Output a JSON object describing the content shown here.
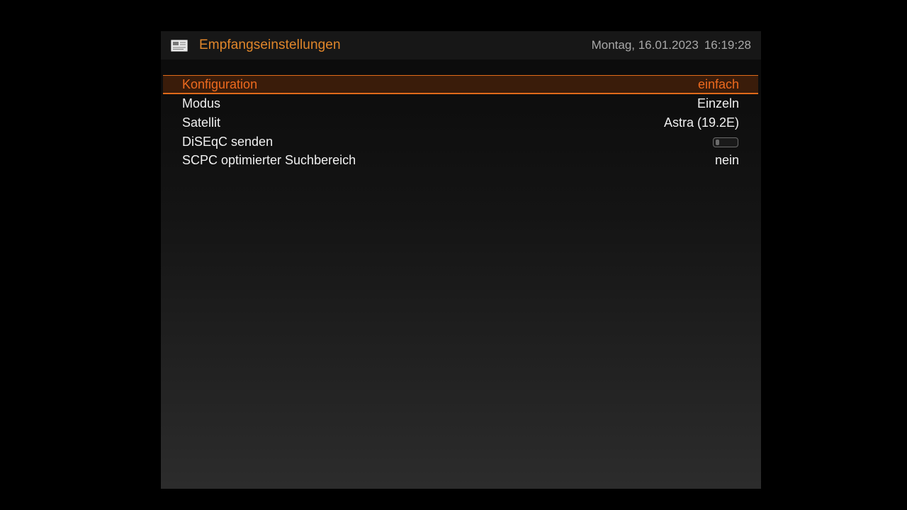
{
  "header": {
    "title": "Empfangseinstellungen",
    "date": "Montag, 16.01.2023",
    "time": "16:19:28",
    "icon": "satellite-dish-icon"
  },
  "menu": {
    "items": [
      {
        "label": "Konfiguration",
        "value": "einfach",
        "selected": true
      },
      {
        "label": "Modus",
        "value": "Einzeln",
        "selected": false
      },
      {
        "label": "Satellit",
        "value": "Astra (19.2E)",
        "selected": false
      },
      {
        "label": "DiSEqC senden",
        "toggle_on": false,
        "selected": false
      },
      {
        "label": "SCPC optimierter Suchbereich",
        "value": "nein",
        "selected": false
      }
    ]
  },
  "colors": {
    "accent": "#ee6a1e",
    "header_title": "#e0862a",
    "selection_bg": "#3a1c0a",
    "text": "#f0f0f0",
    "datetime": "#a8a8a8"
  }
}
